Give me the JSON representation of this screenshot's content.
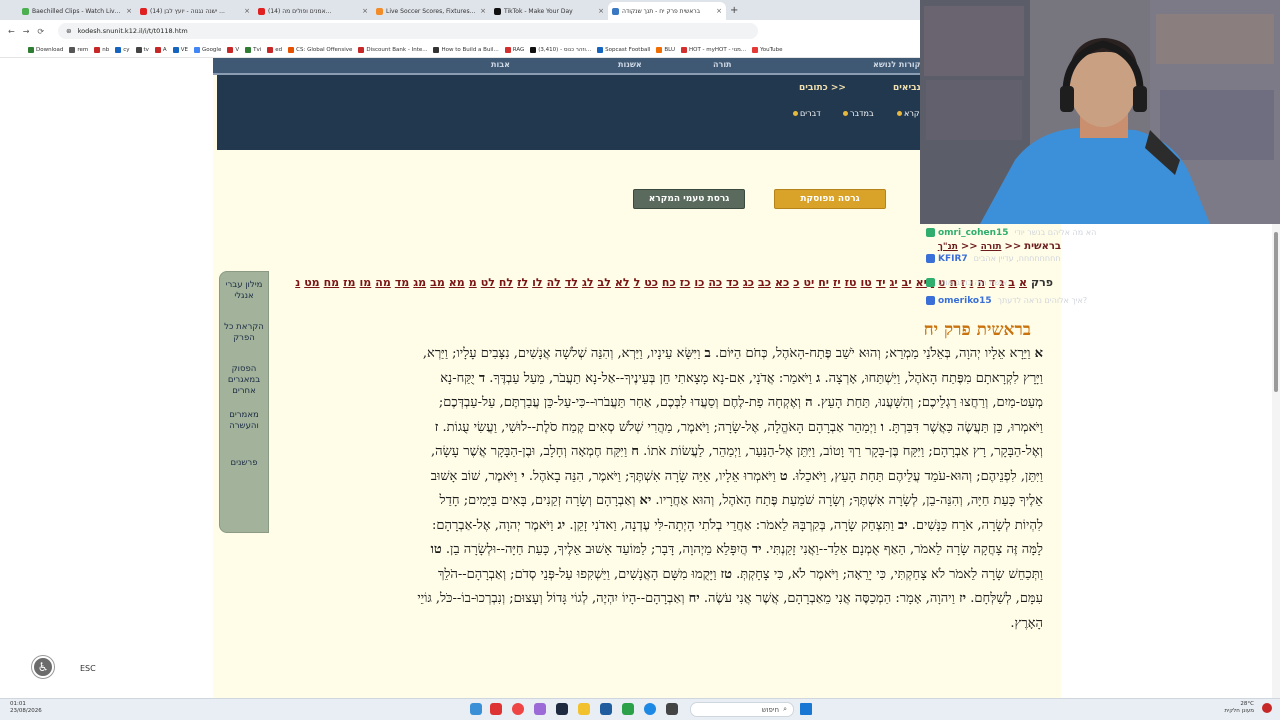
{
  "browser": {
    "tabs": [
      {
        "title": "Baechilled Clips - Watch Live...",
        "color": "#4caf50",
        "active": false
      },
      {
        "title": "(14) ישנה נגנוה - יועץ לבן ...",
        "color": "#e02020",
        "active": false
      },
      {
        "title": "(14) אמנים ופולים מה...",
        "color": "#e02020",
        "active": false
      },
      {
        "title": "Live Soccer Scores, Fixtures, Re...",
        "color": "#f28c28",
        "active": false
      },
      {
        "title": "TikTok - Make Your Day",
        "color": "#111111",
        "active": false
      },
      {
        "title": "בראשית פרק יח - תנך שנקודה",
        "color": "#3a78c2",
        "active": true
      }
    ],
    "new_tab": "+",
    "url": "kodesh.snunit.k12.il/i/t/t0118.htm",
    "bookmarks": [
      "Download",
      "rem",
      "nb",
      "cy",
      "tv",
      "A",
      "VE",
      "Google",
      "V",
      "Tvi",
      "ed",
      "CS: Global Offensive",
      "Discount Bank - Inte...",
      "How to Build a Buil...",
      "RAG",
      "(3,410) - וזהר כנוס...",
      "Sopcast Football",
      "BLU",
      "HOT - myHOT - מנוי...",
      "YouTube"
    ]
  },
  "site": {
    "nav_top": [
      "אבות",
      "אשנות",
      "תורה",
      "משנה ומקורות לנושא"
    ],
    "nav_main": {
      "ketuvim": "כתובים >>",
      "neviim": "נביאים >>"
    },
    "sub_nav": [
      "דברים",
      "במדבר",
      "ויקרא"
    ],
    "btn_teamim": "גרסת טעמי המקרא",
    "btn_print": "גרסה מפוסקת",
    "side_menu": [
      "מילון עברי אנגלי",
      "הקראת כל הפרק",
      "הפסוק במאגרים אחרים",
      "מאמרים והעשרה",
      "פרשנים"
    ],
    "breadcrumb": {
      "torah": "תורה",
      "sep": "<<",
      "book": "בראשית",
      "tanakh": "תנ\"ך"
    },
    "chapter_label": "פרק",
    "chapters": [
      "א",
      "ב",
      "ג",
      "ד",
      "ה",
      "ו",
      "ז",
      "ח",
      "ט",
      "י",
      "יא",
      "יב",
      "יג",
      "יד",
      "טו",
      "טז",
      "יז",
      "יח",
      "יט",
      "כ",
      "כא",
      "כב",
      "כג",
      "כד",
      "כה",
      "כו",
      "כז",
      "כח",
      "כט",
      "ל",
      "לא",
      "לב",
      "לג",
      "לד",
      "לה",
      "לו",
      "לז",
      "לח",
      "לט",
      "מ",
      "מא",
      "מב",
      "מג",
      "מד",
      "מה",
      "מו",
      "מז",
      "מח",
      "מט",
      "נ"
    ],
    "chapter_title": "בראשית פרק יח",
    "verses": [
      {
        "n": "א",
        "t": "וַיֵּרָא אֵלָיו יְהוָה, בְּאֵלֹנֵי מַמְרֵא; וְהוּא יֹשֵׁב פֶּתַח-הָאֹהֶל, כְּחֹם הַיּוֹם."
      },
      {
        "n": "ב",
        "t": "וַיִּשָּׂא עֵינָיו, וַיַּרְא, וְהִנֵּה שְׁלֹשָׁה אֲנָשִׁים, נִצָּבִים עָלָיו; וַיַּרְא, וַיָּרָץ לִקְרָאתָם מִפֶּתַח הָאֹהֶל, וַיִּשְׁתַּחוּ, אָרְצָה."
      },
      {
        "n": "ג",
        "t": "וַיֹּאמַר: אֲדֹנָי, אִם-נָא מָצָאתִי חֵן בְּעֵינֶיךָ--אַל-נָא תַעֲבֹר, מֵעַל עַבְדֶּךָ."
      },
      {
        "n": "ד",
        "t": "יֻקַּח-נָא מְעַט-מַיִם, וְרַחֲצוּ רַגְלֵיכֶם; וְהִשָּׁעֲנוּ, תַּחַת הָעֵץ."
      },
      {
        "n": "ה",
        "t": "וְאֶקְחָה פַת-לֶחֶם וְסַעֲדוּ לִבְּכֶם, אַחַר תַּעֲבֹרוּ--כִּי-עַל-כֵּן עֲבַרְתֶּם, עַל-עַבְדְּכֶם; וַיֹּאמְרוּ, כֵּן תַּעֲשֶׂה כַּאֲשֶׁר דִּבַּרְתָּ."
      },
      {
        "n": "ו",
        "t": "וַיְמַהֵר אַבְרָהָם הָאֹהֱלָה, אֶל-שָׂרָה; וַיֹּאמֶר, מַהֲרִי שְׁלֹשׁ סְאִים קֶמַח סֹלֶת--לוּשִׁי, וַעֲשִׂי עֻגוֹת."
      },
      {
        "n": "ז",
        "t": "וְאֶל-הַבָּקָר, רָץ אַבְרָהָם; וַיִּקַּח בֶּן-בָּקָר רַךְ וָטוֹב, וַיִּתֵּן אֶל-הַנַּעַר, וַיְמַהֵר, לַעֲשׂוֹת אֹתוֹ."
      },
      {
        "n": "ח",
        "t": "וַיִּקַּח חֶמְאָה וְחָלָב, וּבֶן-הַבָּקָר אֲשֶׁר עָשָׂה, וַיִּתֵּן, לִפְנֵיהֶם; וְהוּא-עֹמֵד עֲלֵיהֶם תַּחַת הָעֵץ, וַיֹּאכֵלוּ."
      },
      {
        "n": "ט",
        "t": "וַיֹּאמְרוּ אֵלָיו, אַיֵּה שָׂרָה אִשְׁתֶּךָ; וַיֹּאמֶר, הִנֵּה בָאֹהֶל."
      },
      {
        "n": "י",
        "t": "וַיֹּאמֶר, שׁוֹב אָשׁוּב אֵלֶיךָ כָּעֵת חַיָּה, וְהִנֵּה-בֵן, לְשָׂרָה אִשְׁתֶּךָ; וְשָׂרָה שֹׁמַעַת פֶּתַח הָאֹהֶל, וְהוּא אַחֲרָיו."
      },
      {
        "n": "יא",
        "t": "וְאַבְרָהָם וְשָׂרָה זְקֵנִים, בָּאִים בַּיָּמִים; חָדַל לִהְיוֹת לְשָׂרָה, אֹרַח כַּנָּשִׁים."
      },
      {
        "n": "יב",
        "t": "וַתִּצְחַק שָׂרָה, בְּקִרְבָּהּ לֵאמֹר: אַחֲרֵי בְלֹתִי הָיְתָה-לִּי עֶדְנָה, וַאדֹנִי זָקֵן."
      },
      {
        "n": "יג",
        "t": "וַיֹּאמֶר יְהוָה, אֶל-אַבְרָהָם: לָמָּה זֶּה צָחֲקָה שָׂרָה לֵאמֹר, הַאַף אֻמְנָם אֵלֵד--וַאֲנִי זָקַנְתִּי."
      },
      {
        "n": "יד",
        "t": "הֲיִפָּלֵא מֵיְהוָה, דָּבָר; לַמּוֹעֵד אָשׁוּב אֵלֶיךָ, כָּעֵת חַיָּה--וּלְשָׂרָה בֵן."
      },
      {
        "n": "טו",
        "t": "וַתְּכַחֵשׁ שָׂרָה לֵאמֹר לֹא צָחַקְתִּי, כִּי יָרֵאָה; וַיֹּאמֶר לֹא, כִּי צָחָקְתְּ."
      },
      {
        "n": "טז",
        "t": "וַיָּקֻמוּ מִשָּׁם הָאֲנָשִׁים, וַיַּשְׁקִפוּ עַל-פְּנֵי סְדֹם; וְאַבְרָהָם--הֹלֵךְ עִמָּם, לְשַׁלְּחָם."
      },
      {
        "n": "יז",
        "t": "וַיהוָה, אָמָר: הַמְכַסֶּה אֲנִי מֵאַבְרָהָם, אֲשֶׁר אֲנִי עֹשֶׂה."
      },
      {
        "n": "יח",
        "t": "וְאַבְרָהָם--הָיוֹ יִהְיֶה, לְגוֹי גָּדוֹל וְעָצוּם; וְנִבְרְכוּ-בוֹ--כֹּל, גּוֹיֵי הָאָרֶץ."
      }
    ]
  },
  "overlay": {
    "chat": [
      {
        "user": "omri_cohen15",
        "msg": "הא מה אליהם בנשר יודי"
      },
      {
        "user": "KFIR7",
        "msg": "חחחחחחחח, עדיין אהבים"
      },
      {
        "user": "",
        "msg": "אישה היה כתוב אותו"
      },
      {
        "user": "omeriko15",
        "msg": "איך אלוהים נראה לדעתך?"
      }
    ],
    "esc": "ESC"
  },
  "taskbar": {
    "search": "חיפוש",
    "time": "01:01",
    "date": "23/08/2026",
    "weather": "28°C",
    "weather_desc": "מעונן חלקית"
  },
  "colors": {
    "nav_dark": "#22384f",
    "nav_top": "#3f5874",
    "gold": "#d9a32a",
    "sidebar": "#a2b29b",
    "chapter_red": "#7a1515",
    "title_orange": "#c9730f",
    "page_bg": "#fffde8"
  }
}
